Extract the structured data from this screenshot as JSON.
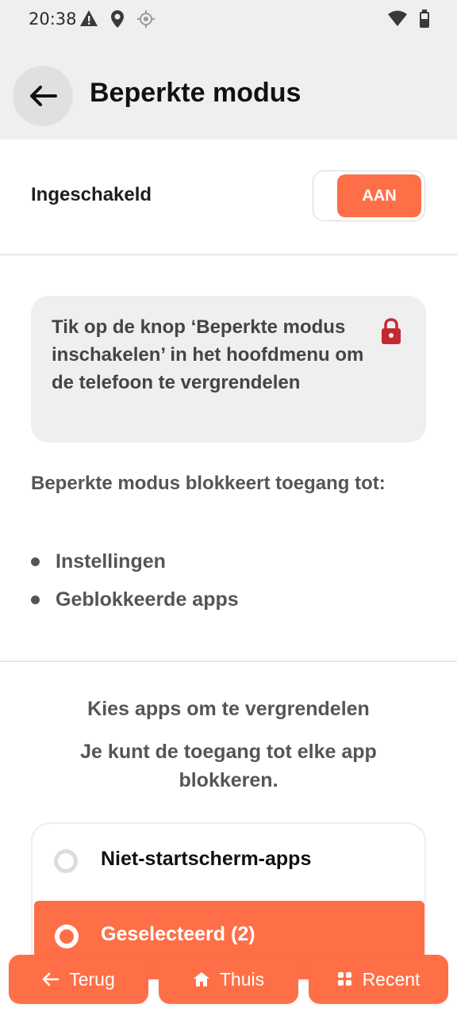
{
  "status_bar": {
    "time": "20:38",
    "icons_left": [
      "warning-icon",
      "location-pin-icon",
      "gps-icon"
    ],
    "icons_right": [
      "wifi-icon",
      "battery-icon"
    ]
  },
  "header": {
    "title": "Beperkte modus",
    "back_icon": "arrow-left-icon"
  },
  "toggle": {
    "label": "Ingeschakeld",
    "state_label": "AAN",
    "enabled": true,
    "accent_color": "#ff6f47"
  },
  "info_card": {
    "text": "Tik op de knop ‘Beperkte modus inschakelen’ in het hoofdmenu om de telefoon te vergrendelen",
    "icon": "lock-icon",
    "icon_color": "#c62833"
  },
  "blocks": {
    "heading": "Beperkte modus blokkeert toegang tot:",
    "items": [
      "Instellingen",
      "Geblokkeerde apps"
    ]
  },
  "choose": {
    "title": "Kies apps om te vergrendelen",
    "subtitle": "Je kunt de toegang tot elke app blokkeren."
  },
  "options": [
    {
      "label": "Niet-startscherm-apps",
      "selected": false
    },
    {
      "label": "Geselecteerd (2)",
      "selected": true
    }
  ],
  "nav": {
    "back": "Terug",
    "home": "Thuis",
    "recent": "Recent"
  }
}
